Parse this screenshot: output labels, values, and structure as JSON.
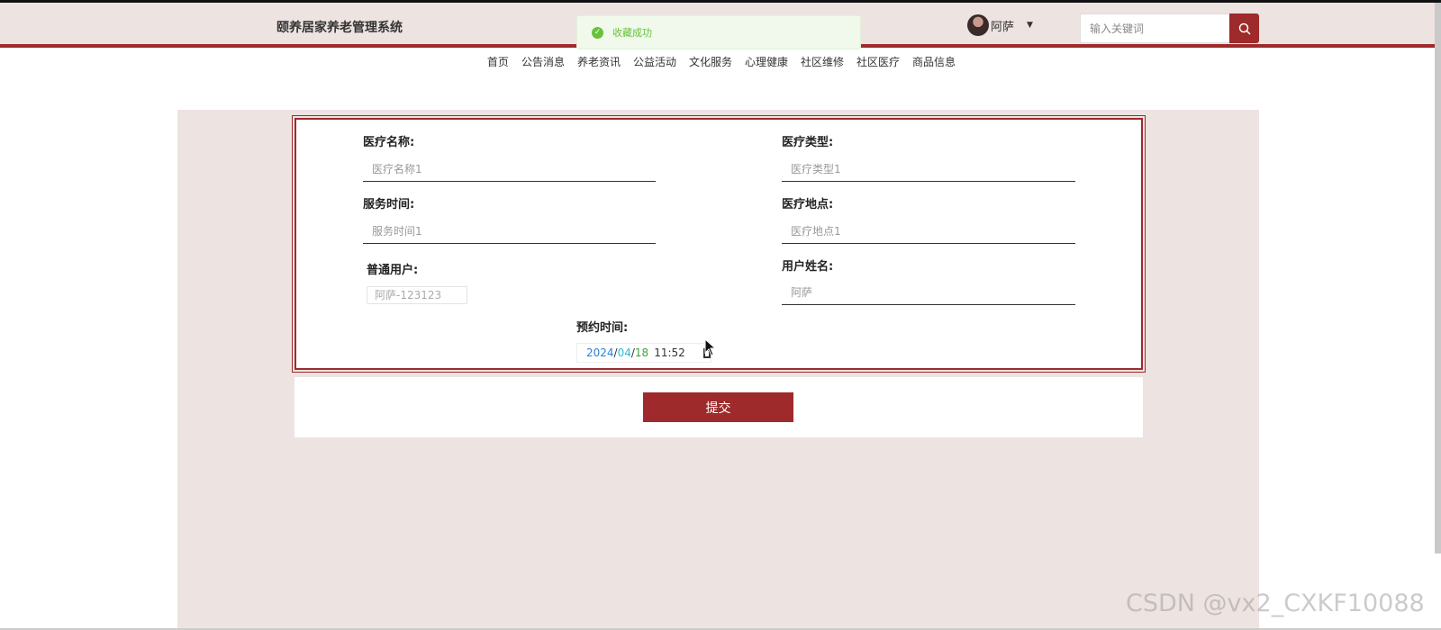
{
  "header": {
    "site_title": "颐养居家养老管理系统",
    "username": "阿萨",
    "search_placeholder": "输入关键词"
  },
  "toast": {
    "message": "收藏成功"
  },
  "nav": {
    "items": [
      "首页",
      "公告消息",
      "养老资讯",
      "公益活动",
      "文化服务",
      "心理健康",
      "社区维修",
      "社区医疗",
      "商品信息"
    ]
  },
  "form": {
    "medical_name": {
      "label": "医疗名称:",
      "placeholder": "医疗名称1"
    },
    "medical_type": {
      "label": "医疗类型:",
      "placeholder": "医疗类型1"
    },
    "service_time": {
      "label": "服务时间:",
      "placeholder": "服务时间1"
    },
    "medical_location": {
      "label": "医疗地点:",
      "placeholder": "医疗地点1"
    },
    "regular_user": {
      "label": "普通用户:",
      "value": "阿萨-123123"
    },
    "user_name": {
      "label": "用户姓名:",
      "placeholder": "阿萨"
    },
    "appointment_time": {
      "label": "预约时间:",
      "year": "2024",
      "month": "04",
      "day": "18",
      "time": "11:52"
    }
  },
  "submit_label": "提交",
  "watermark": "CSDN @vx2_CXKF10088",
  "colors": {
    "accent": "#9e2a2b",
    "header_bg": "#ede3e1",
    "success": "#67c23a"
  },
  "icons": {
    "search": "search-icon",
    "toast": "check-circle-icon",
    "calendar": "calendar-icon"
  }
}
